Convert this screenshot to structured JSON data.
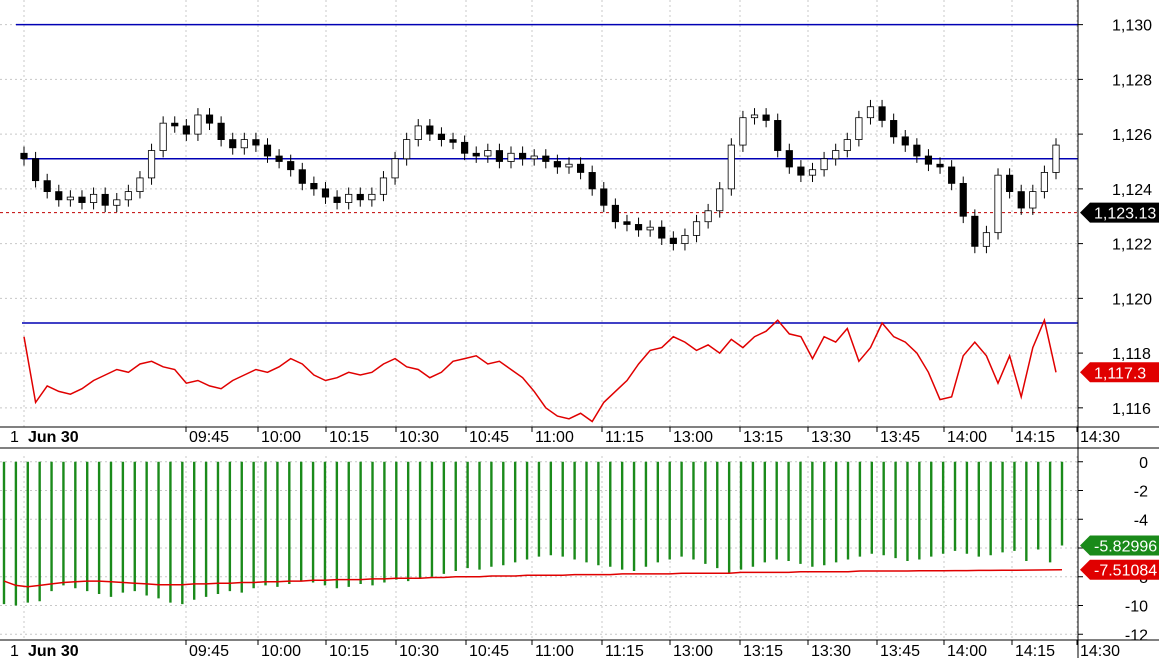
{
  "colors": {
    "grid": "#c8c8c8",
    "level_line": "#0000b4",
    "candle_up_fill": "#ffffff",
    "candle_down_fill": "#000000",
    "candle_outline": "#000000",
    "spread_line": "#e00000",
    "histogram": "#1a8a1a",
    "signal_line": "#e00000",
    "last_label_dark": "#000000",
    "last_label_red": "#e00000",
    "last_label_green": "#1a8a1a",
    "current_price_dotted": "#c00000"
  },
  "price_labels": {
    "last_price": "1,123.13",
    "spread_last": "1,117.3"
  },
  "osc_labels": {
    "histogram_last": "-5.82996",
    "signal_last": "-7.51084"
  },
  "date_label": "Jun 30",
  "left_marker": "1",
  "chart_data": [
    {
      "type": "candlestick",
      "panel": "price",
      "y_ticks": [
        "1,130",
        "1,128",
        "1,126",
        "1,124",
        "1,122",
        "1,120",
        "1,118",
        "1,116"
      ],
      "y_tick_values": [
        1130,
        1128,
        1126,
        1124,
        1122,
        1120,
        1118,
        1116
      ],
      "ylim": [
        1115.3,
        1130.9
      ],
      "x_ticks": [
        "09:45",
        "10:00",
        "10:15",
        "10:30",
        "10:45",
        "11:00",
        "11:15",
        "13:00",
        "13:15",
        "13:30",
        "13:45",
        "14:00",
        "14:15",
        "14:30"
      ],
      "horizontal_levels": [
        1130.0,
        1125.1,
        1119.1
      ],
      "current_price": 1123.13,
      "series": [
        {
          "name": "price_close",
          "values": [
            1125.1,
            1124.3,
            1123.9,
            1123.6,
            1123.7,
            1123.5,
            1123.8,
            1123.4,
            1123.6,
            1123.9,
            1124.4,
            1125.4,
            1126.4,
            1126.3,
            1126.0,
            1126.7,
            1126.4,
            1125.8,
            1125.5,
            1125.8,
            1125.6,
            1125.2,
            1125.0,
            1124.7,
            1124.2,
            1124.0,
            1123.7,
            1123.5,
            1123.8,
            1123.6,
            1123.8,
            1124.4,
            1125.1,
            1125.8,
            1126.3,
            1126.0,
            1125.8,
            1125.7,
            1125.3,
            1125.2,
            1125.4,
            1125.0,
            1125.3,
            1125.1,
            1125.2,
            1125.0,
            1124.8,
            1124.9,
            1124.6,
            1124.0,
            1123.4,
            1122.8,
            1122.7,
            1122.5,
            1122.6,
            1122.2,
            1122.0,
            1122.3,
            1122.8,
            1123.2,
            1124.0,
            1125.6,
            1126.6,
            1126.7,
            1126.5,
            1125.4,
            1124.8,
            1124.5,
            1124.7,
            1125.1,
            1125.4,
            1125.8,
            1126.6,
            1127.0,
            1126.5,
            1125.9,
            1125.6,
            1125.2,
            1124.9,
            1124.8,
            1124.2,
            1123.0,
            1121.9,
            1122.4,
            1124.5,
            1123.9,
            1123.3,
            1123.9,
            1124.6,
            1125.6
          ]
        },
        {
          "name": "spread",
          "values": [
            1118.6,
            1116.2,
            1116.8,
            1116.6,
            1116.5,
            1116.7,
            1117.0,
            1117.2,
            1117.4,
            1117.3,
            1117.6,
            1117.7,
            1117.5,
            1117.4,
            1116.9,
            1117.0,
            1116.8,
            1116.7,
            1117.0,
            1117.2,
            1117.4,
            1117.3,
            1117.5,
            1117.8,
            1117.6,
            1117.2,
            1117.0,
            1117.1,
            1117.3,
            1117.2,
            1117.3,
            1117.6,
            1117.8,
            1117.5,
            1117.4,
            1117.1,
            1117.3,
            1117.7,
            1117.8,
            1117.9,
            1117.6,
            1117.7,
            1117.4,
            1117.1,
            1116.6,
            1116.0,
            1115.7,
            1115.6,
            1115.8,
            1115.5,
            1116.2,
            1116.6,
            1117.0,
            1117.6,
            1118.1,
            1118.2,
            1118.6,
            1118.4,
            1118.1,
            1118.3,
            1118.0,
            1118.5,
            1118.2,
            1118.6,
            1118.8,
            1119.2,
            1118.7,
            1118.6,
            1117.8,
            1118.6,
            1118.4,
            1118.9,
            1117.7,
            1118.2,
            1119.1,
            1118.6,
            1118.4,
            1118.0,
            1117.3,
            1116.3,
            1116.4,
            1117.9,
            1118.4,
            1117.9,
            1116.9,
            1117.9,
            1116.4,
            1118.2,
            1119.2,
            1117.3
          ]
        }
      ]
    },
    {
      "type": "bar",
      "panel": "oscillator",
      "y_ticks": [
        "0",
        "-2",
        "-4",
        "-6",
        "-8",
        "-10",
        "-12"
      ],
      "y_tick_values": [
        0,
        -2,
        -4,
        -6,
        -8,
        -10,
        -12
      ],
      "ylim": [
        -12.4,
        0.4
      ],
      "x_ticks": [
        "09:45",
        "10:00",
        "10:15",
        "10:30",
        "10:45",
        "11:00",
        "11:15",
        "13:00",
        "13:15",
        "13:30",
        "13:45",
        "14:00",
        "14:15",
        "14:30"
      ],
      "series": [
        {
          "name": "histogram",
          "values": [
            -9.9,
            -10.0,
            -9.8,
            -9.7,
            -9.0,
            -8.6,
            -8.8,
            -9.0,
            -9.2,
            -9.4,
            -9.1,
            -9.0,
            -9.3,
            -9.5,
            -9.8,
            -9.9,
            -9.6,
            -9.4,
            -9.2,
            -9.0,
            -9.1,
            -8.8,
            -8.6,
            -8.7,
            -8.5,
            -8.3,
            -8.4,
            -8.6,
            -8.8,
            -8.7,
            -8.5,
            -8.6,
            -8.4,
            -8.2,
            -8.3,
            -8.1,
            -8.0,
            -7.8,
            -7.6,
            -7.4,
            -7.5,
            -7.3,
            -7.2,
            -7.0,
            -6.8,
            -6.6,
            -6.5,
            -6.6,
            -6.8,
            -7.0,
            -7.2,
            -7.3,
            -7.5,
            -7.6,
            -7.3,
            -7.0,
            -6.8,
            -6.6,
            -6.8,
            -7.1,
            -7.4,
            -7.7,
            -7.5,
            -7.3,
            -7.0,
            -6.8,
            -6.9,
            -7.1,
            -7.3,
            -7.2,
            -7.0,
            -6.8,
            -6.6,
            -6.4,
            -6.5,
            -6.7,
            -6.9,
            -6.8,
            -6.6,
            -6.4,
            -6.2,
            -6.4,
            -6.6,
            -6.5,
            -6.3,
            -6.2,
            -6.9,
            -6.1,
            -7.0,
            -5.83
          ]
        },
        {
          "name": "signal",
          "values": [
            -8.3,
            -8.6,
            -8.7,
            -8.6,
            -8.5,
            -8.4,
            -8.35,
            -8.3,
            -8.3,
            -8.35,
            -8.4,
            -8.45,
            -8.5,
            -8.55,
            -8.55,
            -8.55,
            -8.5,
            -8.5,
            -8.45,
            -8.45,
            -8.4,
            -8.4,
            -8.35,
            -8.35,
            -8.3,
            -8.3,
            -8.25,
            -8.25,
            -8.2,
            -8.2,
            -8.2,
            -8.15,
            -8.15,
            -8.1,
            -8.1,
            -8.1,
            -8.05,
            -8.05,
            -8.0,
            -8.0,
            -8.0,
            -7.95,
            -7.95,
            -7.95,
            -7.9,
            -7.9,
            -7.9,
            -7.9,
            -7.85,
            -7.85,
            -7.85,
            -7.85,
            -7.8,
            -7.8,
            -7.8,
            -7.8,
            -7.8,
            -7.75,
            -7.75,
            -7.75,
            -7.75,
            -7.75,
            -7.7,
            -7.7,
            -7.7,
            -7.7,
            -7.7,
            -7.65,
            -7.65,
            -7.65,
            -7.65,
            -7.65,
            -7.6,
            -7.6,
            -7.6,
            -7.6,
            -7.6,
            -7.58,
            -7.58,
            -7.58,
            -7.57,
            -7.57,
            -7.56,
            -7.56,
            -7.55,
            -7.55,
            -7.54,
            -7.53,
            -7.52,
            -7.51
          ]
        }
      ]
    }
  ]
}
